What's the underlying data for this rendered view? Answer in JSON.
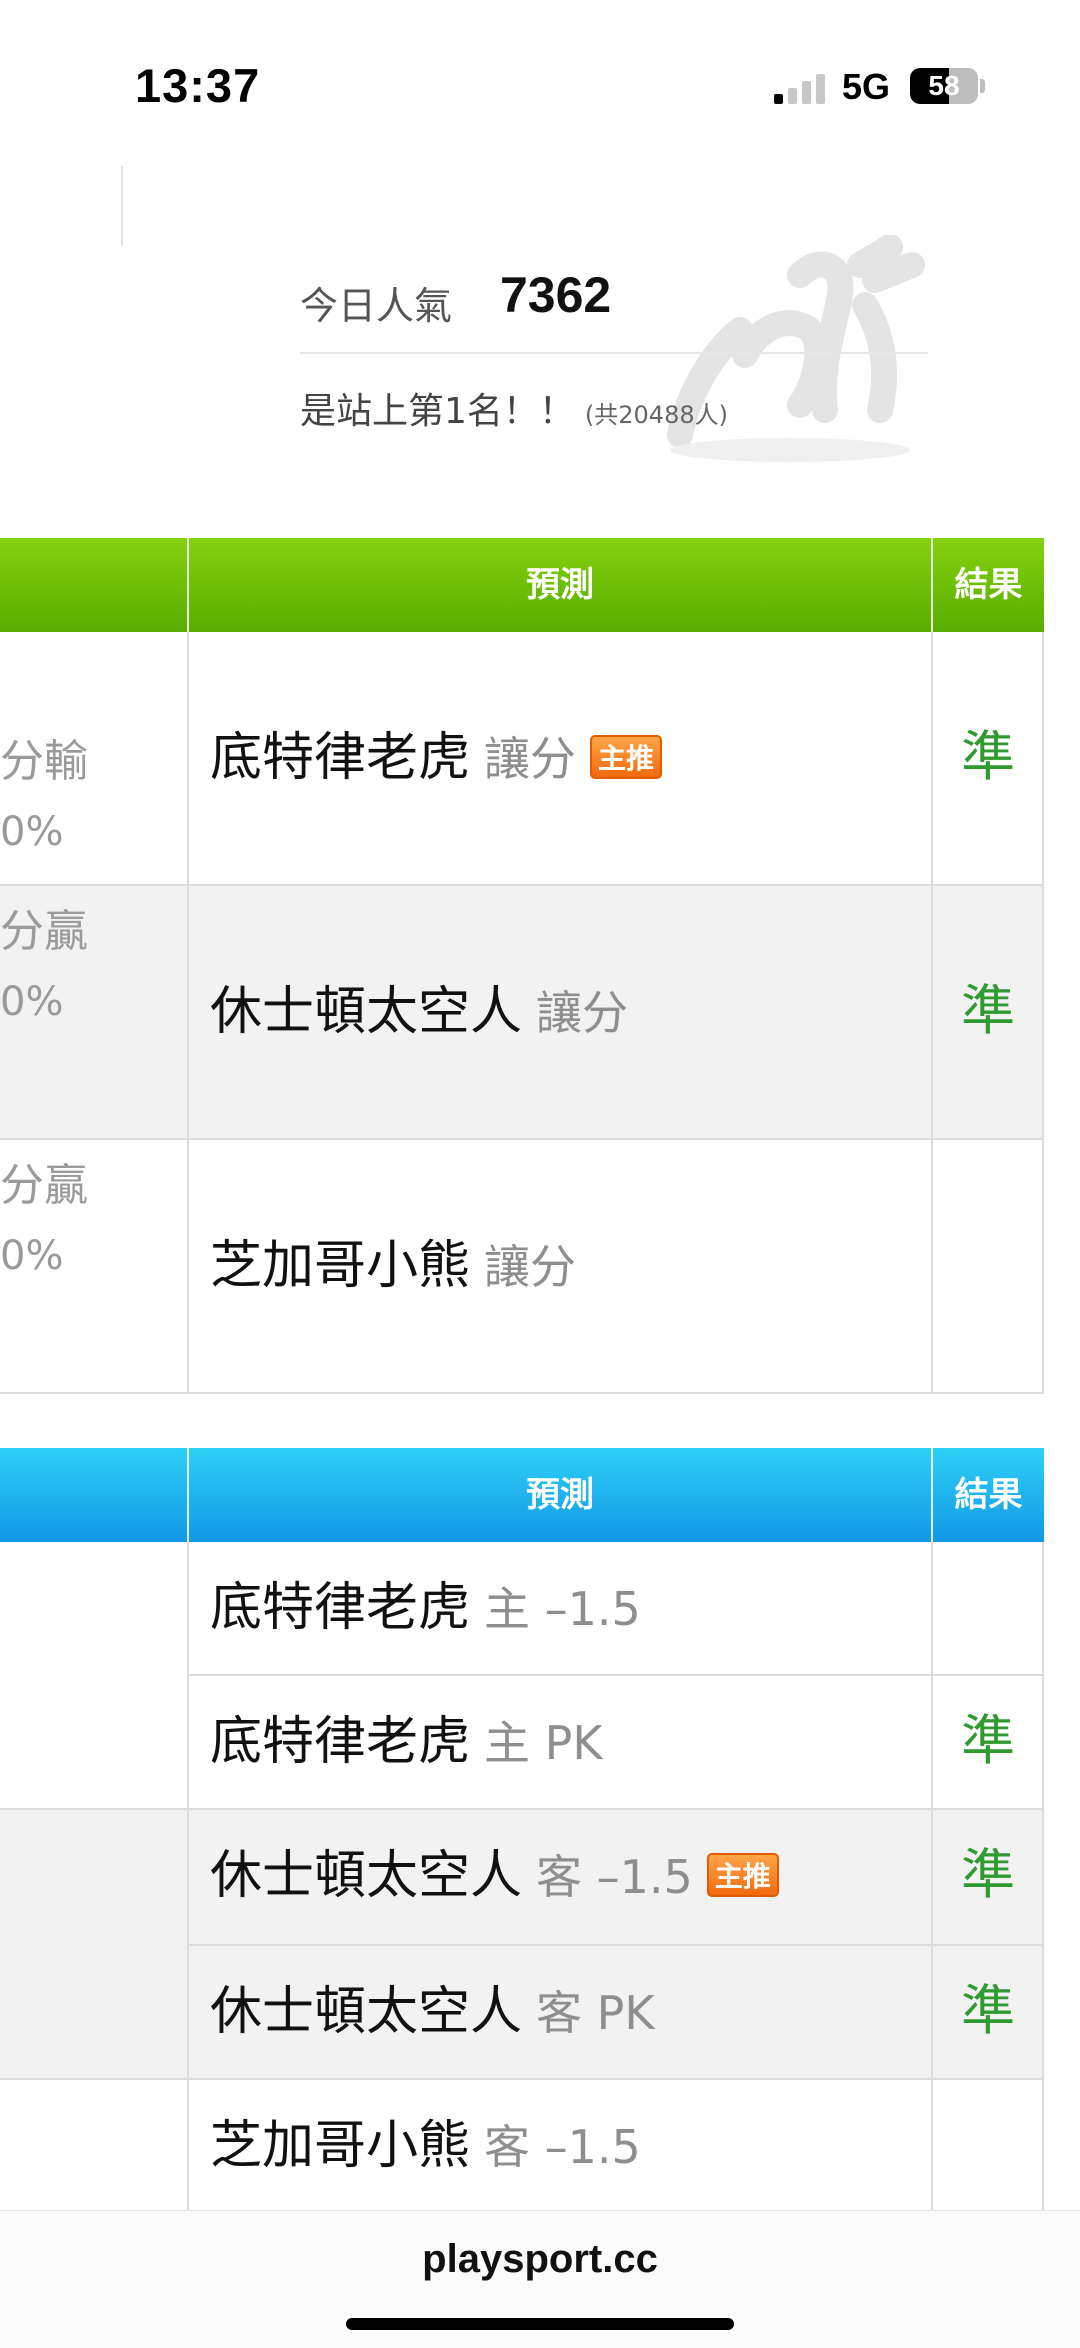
{
  "status_bar": {
    "time": "13:37",
    "network": "5G",
    "battery": "58",
    "battery_level_percent": 58
  },
  "popularity": {
    "label": "今日人氣",
    "value": "7362",
    "rank_text": "是站上第1名！！",
    "total_text": "(共20488人)"
  },
  "table1": {
    "header_color": "#6cc000",
    "headers": {
      "prediction": "預測",
      "result": "結果"
    },
    "rows": [
      {
        "left_line1": "分輸",
        "left_line2": "0%",
        "team": "底特律老虎",
        "bet": "讓分",
        "badge": "主推",
        "result": "準"
      },
      {
        "left_line1": "分贏",
        "left_line2": "0%",
        "team": "休士頓太空人",
        "bet": "讓分",
        "badge": "",
        "result": "準"
      },
      {
        "left_line1": "分贏",
        "left_line2": "0%",
        "team": "芝加哥小熊",
        "bet": "讓分",
        "badge": "",
        "result": ""
      }
    ]
  },
  "table2": {
    "header_color": "#1aa7ea",
    "headers": {
      "prediction": "預測",
      "result": "結果"
    },
    "rows": [
      {
        "team": "底特律老虎",
        "bet": "主 –1.5",
        "badge": "",
        "result": ""
      },
      {
        "team": "底特律老虎",
        "bet": "主 PK",
        "badge": "",
        "result": "準"
      },
      {
        "team": "休士頓太空人",
        "bet": "客 –1.5",
        "badge": "主推",
        "result": "準"
      },
      {
        "team": "休士頓太空人",
        "bet": "客 PK",
        "badge": "",
        "result": "準"
      },
      {
        "team": "芝加哥小熊",
        "bet": "客 –1.5",
        "badge": "",
        "result": ""
      }
    ]
  },
  "browser": {
    "url": "playsport.cc"
  },
  "colors": {
    "result_text": "#2f9a2f",
    "badge": "#f07a1a"
  }
}
